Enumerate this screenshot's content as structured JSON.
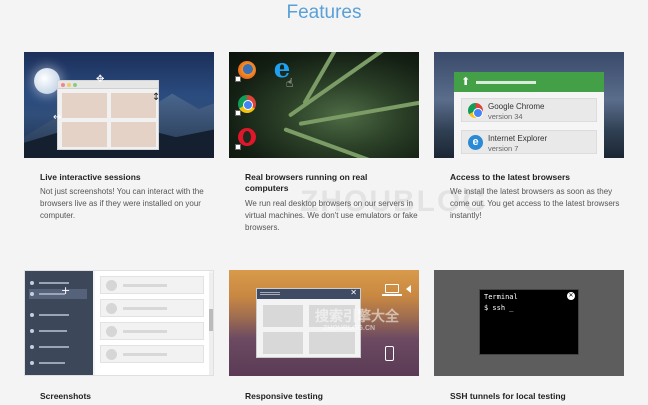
{
  "page": {
    "title": "Features"
  },
  "cards": [
    {
      "title": "Live interactive sessions",
      "desc": "Not just screenshots! You can interact with the browsers live as if they were installed on your computer."
    },
    {
      "title": "Real browsers running on real computers",
      "desc": "We run real desktop browsers on our servers in virtual machines. We don't use emulators or fake browsers."
    },
    {
      "title": "Access to the latest browsers",
      "desc": "We install the latest browsers as soon as they come out. You get access to the latest browsers instantly!"
    },
    {
      "title": "Screenshots",
      "desc": ""
    },
    {
      "title": "Responsive testing",
      "desc": ""
    },
    {
      "title": "SSH tunnels for local testing",
      "desc": ""
    }
  ],
  "latest_browsers": [
    {
      "name": "Google Chrome",
      "version": "version 34",
      "icon": "chrome-icon"
    },
    {
      "name": "Internet Explorer",
      "version": "version 7",
      "icon": "ie-icon"
    }
  ],
  "terminal": {
    "title": "Terminal",
    "command": "$ ssh _"
  },
  "watermark": {
    "top": "ZHOUBLOG",
    "site": "ZHOUBLOG.CN",
    "cn": "搜索引擎大全"
  }
}
